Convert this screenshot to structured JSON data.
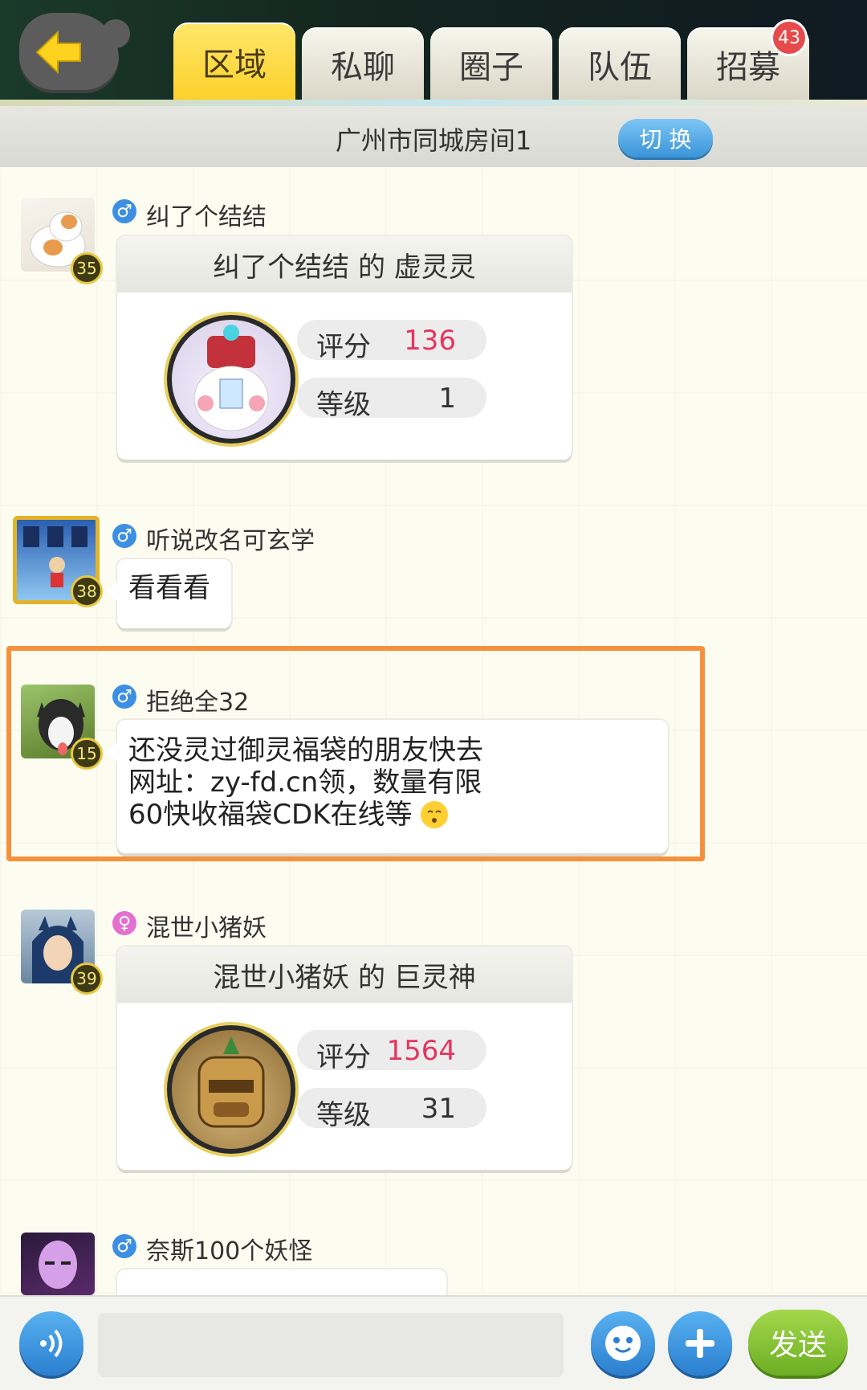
{
  "tabs": [
    {
      "label": "区域",
      "active": true
    },
    {
      "label": "私聊"
    },
    {
      "label": "圈子"
    },
    {
      "label": "队伍"
    },
    {
      "label": "招募",
      "badge": "43"
    }
  ],
  "room": {
    "title": "广州市同城房间1",
    "switch_label": "切 换"
  },
  "messages": [
    {
      "user": "纠了个结结",
      "gender": "male",
      "level": "35",
      "card_title": "纠了个结结 的 虚灵灵",
      "stats": [
        {
          "label": "评分",
          "value": "136"
        },
        {
          "label": "等级",
          "value": "1"
        }
      ]
    },
    {
      "user": "听说改名可玄学",
      "gender": "male",
      "level": "38",
      "text": "看看看"
    },
    {
      "user": "拒绝全32",
      "gender": "male",
      "level": "15",
      "lines": [
        "还没灵过御灵福袋的朋友快去",
        "网址：zy-fd.cn领，数量有限",
        "60快收福袋CDK在线等"
      ]
    },
    {
      "user": "混世小猪妖",
      "gender": "female",
      "level": "39",
      "card_title": "混世小猪妖 的 巨灵神",
      "stats": [
        {
          "label": "评分",
          "value": "1564"
        },
        {
          "label": "等级",
          "value": "31"
        }
      ]
    },
    {
      "user": "奈斯100个妖怪",
      "gender": "male"
    }
  ],
  "bottom": {
    "send_label": "发送",
    "input_placeholder": ""
  },
  "colors": {
    "accent_yellow": "#fbd02a",
    "highlight": "#f5913a",
    "score_red": "#e63460",
    "send_green": "#6cae22"
  }
}
